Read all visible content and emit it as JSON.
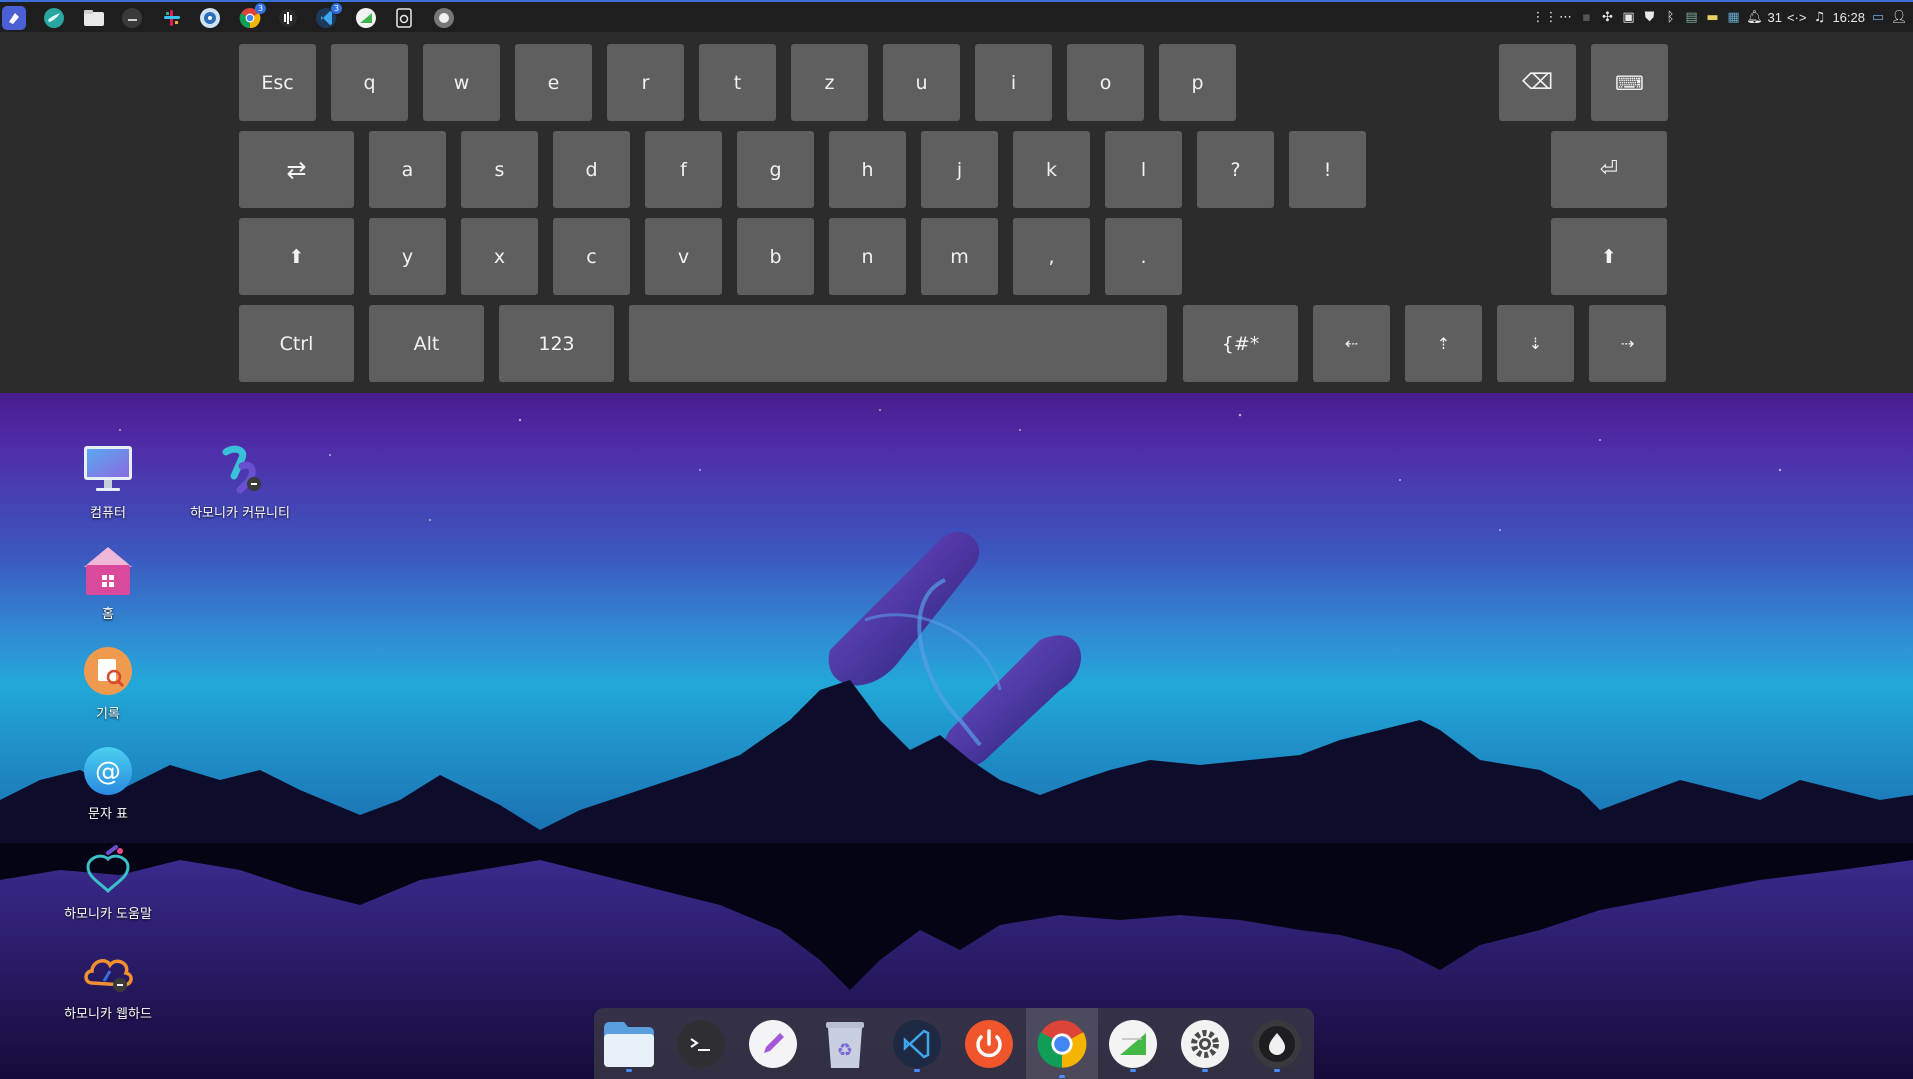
{
  "colors": {
    "panel_bg": "#1e1e1f",
    "keyboard_bg": "#2c2c2d",
    "key_bg": "#5f5f60",
    "accent": "#3a6fd8"
  },
  "top_panel": {
    "apps": [
      {
        "name": "harmonica-launcher-icon",
        "badge": ""
      },
      {
        "name": "swallow-bird-app-icon",
        "badge": ""
      },
      {
        "name": "file-manager-icon",
        "badge": ""
      },
      {
        "name": "terminal-icon",
        "badge": ""
      },
      {
        "name": "slack-icon",
        "badge": ""
      },
      {
        "name": "disk-app-icon",
        "badge": ""
      },
      {
        "name": "chrome-icon",
        "badge": "3"
      },
      {
        "name": "voice-app-icon",
        "badge": ""
      },
      {
        "name": "vscode-icon",
        "badge": "3"
      },
      {
        "name": "whiteboard-app-icon",
        "badge": ""
      },
      {
        "name": "settings-doc-icon",
        "badge": ""
      },
      {
        "name": "record-app-icon",
        "badge": ""
      }
    ],
    "tray": {
      "date_number": "31",
      "network_label": "<·>",
      "clock": "16:28"
    }
  },
  "keyboard": {
    "row1": [
      "Esc",
      "q",
      "w",
      "e",
      "r",
      "t",
      "z",
      "u",
      "i",
      "o",
      "p"
    ],
    "backspace_glyph": "⌫",
    "hide_keyboard_glyph": "⌨",
    "row2_switch_glyph": "⇄",
    "row2": [
      "a",
      "s",
      "d",
      "f",
      "g",
      "h",
      "j",
      "k",
      "l",
      "?",
      "!"
    ],
    "enter_glyph": "⏎",
    "shift_glyph": "⬆",
    "row3": [
      "y",
      "x",
      "c",
      "v",
      "b",
      "n",
      "m",
      ",",
      "."
    ],
    "row4": {
      "ctrl": "Ctrl",
      "alt": "Alt",
      "numbers": "123",
      "space": "",
      "symbols": "{#*",
      "left": "⇠",
      "up": "⇡",
      "down": "⇣",
      "right": "⇢"
    }
  },
  "desktop": {
    "icons": [
      {
        "label": "컴퓨터",
        "icon": "computer-icon"
      },
      {
        "label": "하모니카 커뮤니티",
        "icon": "harmonica-community-icon"
      },
      {
        "label": "홈",
        "icon": "home-folder-icon"
      },
      {
        "label": "기록",
        "icon": "history-icon"
      },
      {
        "label": "문자 표",
        "icon": "character-map-icon"
      },
      {
        "label": "하모니카 도움말",
        "icon": "help-icon"
      },
      {
        "label": "하모니카 웹하드",
        "icon": "webhard-icon"
      }
    ]
  },
  "dock": {
    "items": [
      {
        "name": "files-dock-icon",
        "active": false
      },
      {
        "name": "terminal-dock-icon",
        "active": false
      },
      {
        "name": "text-editor-dock-icon",
        "active": false
      },
      {
        "name": "trash-dock-icon",
        "active": false
      },
      {
        "name": "vscode-dock-icon",
        "active": false
      },
      {
        "name": "power-dock-icon",
        "active": false
      },
      {
        "name": "chrome-dock-icon",
        "active": true
      },
      {
        "name": "whiteboard-dock-icon",
        "active": false
      },
      {
        "name": "settings-dock-icon",
        "active": false
      },
      {
        "name": "record-dock-icon",
        "active": false
      }
    ]
  }
}
